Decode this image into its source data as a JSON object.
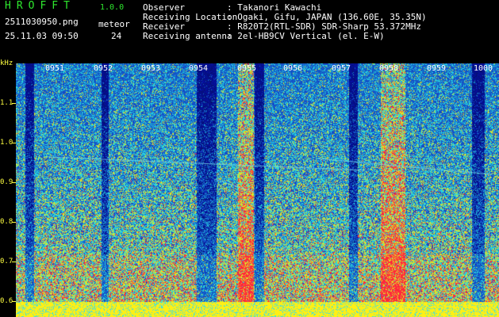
{
  "header": {
    "app_title": "HROFFT",
    "app_version": "1.0.0",
    "file_name": "2511030950.png",
    "meteor_label": "meteor",
    "date_time": "25.11.03 09:50",
    "meteor_count": "24",
    "info": [
      {
        "key": "Observer",
        "value": ": Takanori Kawachi"
      },
      {
        "key": "Receiving Location",
        "value": ": Ogaki, Gifu, JAPAN (136.60E, 35.35N)"
      },
      {
        "key": "Receiver",
        "value": ": R820T2(RTL-SDR) SDR-Sharp 53.372MHz"
      },
      {
        "key": "Receiving antenna",
        "value": ": 2el-HB9CV Vertical (el. E-W)"
      }
    ]
  },
  "y_axis": {
    "unit": "kHz",
    "ticks": [
      "1.1",
      "1.0",
      "0.9",
      "0.8",
      "0.7",
      "0.6"
    ]
  },
  "x_axis": {
    "ticks": [
      "0951",
      "0952",
      "0953",
      "0954",
      "0955",
      "0956",
      "0957",
      "0958",
      "0959",
      "1000"
    ]
  },
  "colors": {
    "background": "#000000",
    "title_green": "#2ee82e",
    "axis_yellow": "#ffff40",
    "spectrogram_base": "#0a1aa0",
    "signal_cyan": "#30e0e0",
    "signal_yellow": "#ffff00",
    "signal_red": "#ff3040"
  }
}
